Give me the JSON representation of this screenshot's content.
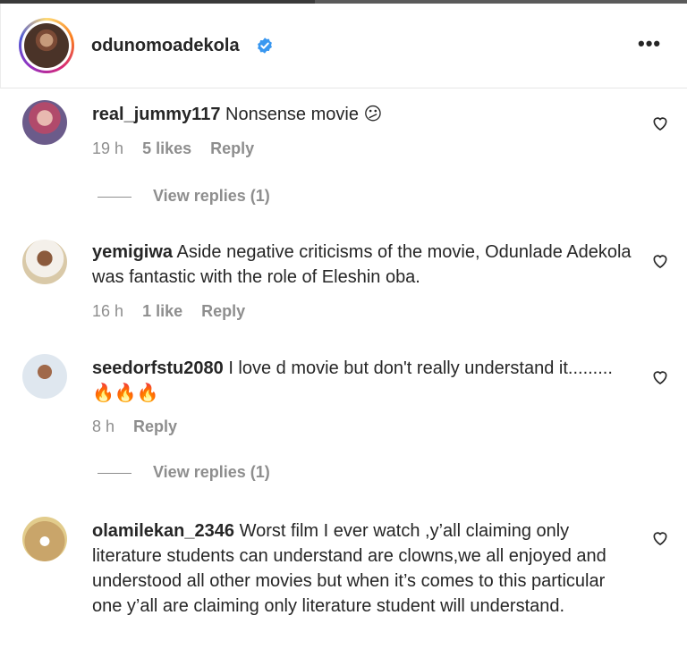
{
  "post": {
    "owner_username": "odunomoadekola",
    "verified_icon": "verified-badge-icon",
    "more_label": "•••"
  },
  "comments": [
    {
      "username": "real_jummy117",
      "text": "Nonsense movie",
      "emoji": "😕",
      "time": "19 h",
      "likes": "5 likes",
      "reply_label": "Reply",
      "view_replies": "View replies (1)"
    },
    {
      "username": "yemigiwa",
      "text": "Aside negative criticisms of the movie, Odunlade Adekola was fantastic with the role of Eleshin oba.",
      "time": "16 h",
      "likes": "1 like",
      "reply_label": "Reply"
    },
    {
      "username": "seedorfstu2080",
      "text": "I love d movie but don't really understand it.........",
      "emoji": "🔥🔥🔥",
      "time": "8 h",
      "reply_label": "Reply",
      "view_replies": "View replies (1)"
    },
    {
      "username": "olamilekan_2346",
      "text": "Worst film I ever watch ,y’all claiming only literature students can understand are clowns,we all enjoyed and understood all other movies but when it’s comes to this particular one y’all are claiming only literature student will understand."
    }
  ],
  "colors": {
    "text": "#262626",
    "meta": "#8e8e8e",
    "verified": "#3897f0"
  }
}
